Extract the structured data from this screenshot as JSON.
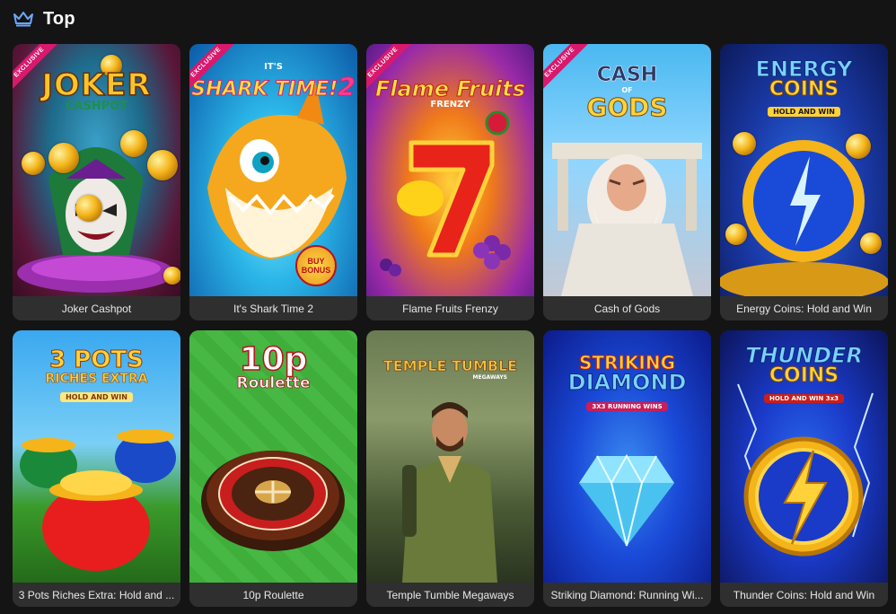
{
  "section": {
    "title": "Top",
    "icon": "crown-icon",
    "accent": "#6aa7ff"
  },
  "games": [
    {
      "title": "Joker Cashpot",
      "exclusive": true,
      "logo": "JOKER",
      "logo_sub": "CASHPOT"
    },
    {
      "title": "It's Shark Time 2",
      "exclusive": true,
      "logo": "SHARK TIME!",
      "logo_pre": "IT'S",
      "logo_num": "2",
      "badge": "BUY BONUS"
    },
    {
      "title": "Flame Fruits Frenzy",
      "exclusive": true,
      "logo": "Flame Fruits",
      "logo_sub": "FRENZY"
    },
    {
      "title": "Cash of Gods",
      "exclusive": true,
      "logo": "CASH",
      "logo_of": "OF",
      "logo_sub": "GODS"
    },
    {
      "title": "Energy Coins: Hold and Win",
      "exclusive": false,
      "logo": "ENERGY",
      "logo_sub": "COINS",
      "logo_tag": "HOLD AND WIN"
    },
    {
      "title": "3 Pots Riches Extra: Hold and ...",
      "exclusive": false,
      "logo": "3 POTS",
      "logo_sub": "RICHES EXTRA",
      "logo_tag": "HOLD AND WIN"
    },
    {
      "title": "10p Roulette",
      "exclusive": false,
      "logo": "10p",
      "logo_sub": "Roulette"
    },
    {
      "title": "Temple Tumble Megaways",
      "exclusive": false,
      "logo": "TEMPLE TUMBLE",
      "logo_sub": "MEGAWAYS"
    },
    {
      "title": "Striking Diamond: Running Wi...",
      "exclusive": false,
      "logo": "STRIKING",
      "logo_sub": "DIAMOND",
      "logo_tag": "3X3 RUNNING WINS"
    },
    {
      "title": "Thunder Coins: Hold and Win",
      "exclusive": false,
      "logo": "THUNDER",
      "logo_sub": "COINS",
      "logo_tag": "HOLD AND WIN 3x3"
    }
  ],
  "ribbon_label": "EXCLUSIVE"
}
